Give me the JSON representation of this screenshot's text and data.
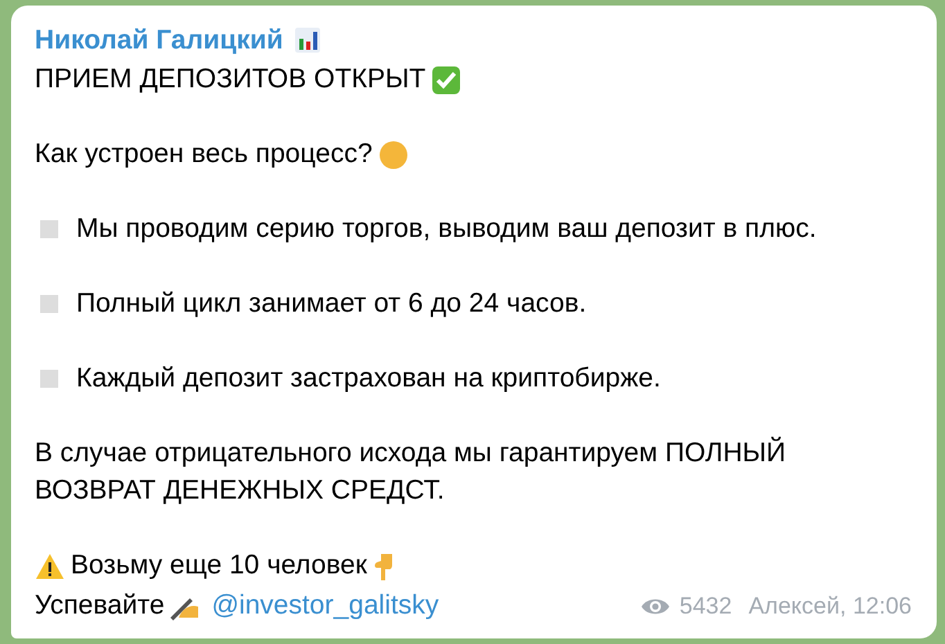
{
  "sender": {
    "name": "Николай Галицкий"
  },
  "lines": [
    {
      "kind": "text",
      "text": "ПРИЕМ ДЕПОЗИТОВ ОТКРЫТ"
    },
    {
      "kind": "gap"
    },
    {
      "kind": "text",
      "text": "Как устроен весь процесс?"
    },
    {
      "kind": "gap"
    },
    {
      "kind": "bullet",
      "text": "Мы проводим серию торгов, выводим ваш депозит в плюс."
    },
    {
      "kind": "gap"
    },
    {
      "kind": "bullet",
      "text": "Полный цикл занимает от 6 до 24 часов."
    },
    {
      "kind": "gap"
    },
    {
      "kind": "bullet",
      "text": "Каждый депозит застрахован на криптобирже."
    },
    {
      "kind": "gap"
    },
    {
      "kind": "text",
      "text": "В случае отрицательного исхода мы гарантируем ПОЛНЫЙ ВОЗВРАТ ДЕНЕЖНЫХ СРЕДСТ."
    },
    {
      "kind": "gap"
    },
    {
      "kind": "text",
      "text": "Возьму еще 10 человек"
    }
  ],
  "last_line": {
    "text": "Успевайте",
    "link": "@investor_galitsky"
  },
  "footer": {
    "views": "5432",
    "author": "Алексей, 12:06"
  }
}
